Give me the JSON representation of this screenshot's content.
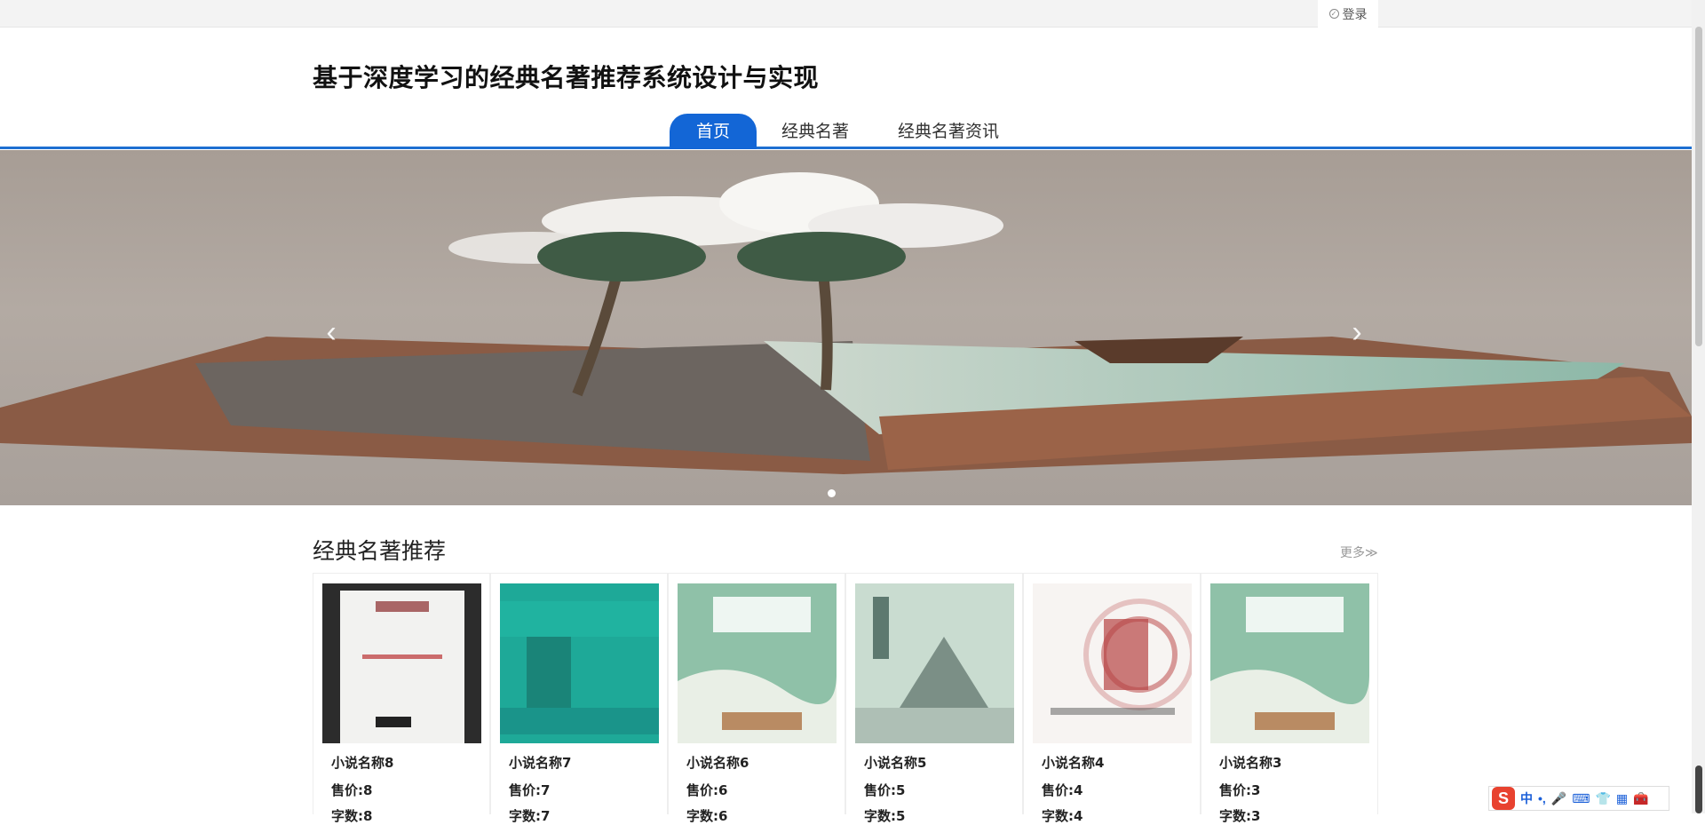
{
  "header": {
    "login_label": "登录",
    "site_title": "基于深度学习的经典名著推荐系统设计与实现"
  },
  "nav": {
    "items": [
      {
        "label": "首页",
        "active": true
      },
      {
        "label": "经典名著",
        "active": false
      },
      {
        "label": "经典名著资讯",
        "active": false
      }
    ]
  },
  "banner": {
    "prev_icon": "chevron-left-icon",
    "next_icon": "chevron-right-icon",
    "prev_glyph": "‹",
    "next_glyph": "›",
    "slides_count": 1
  },
  "recommend": {
    "title": "经典名著推荐",
    "more_label": "更多≫",
    "books": [
      {
        "name": "小说名称8",
        "price": "售价:8",
        "extra": "字数:8"
      },
      {
        "name": "小说名称7",
        "price": "售价:7",
        "extra": "字数:7"
      },
      {
        "name": "小说名称6",
        "price": "售价:6",
        "extra": "字数:6"
      },
      {
        "name": "小说名称5",
        "price": "售价:5",
        "extra": "字数:5"
      },
      {
        "name": "小说名称4",
        "price": "售价:4",
        "extra": "字数:4"
      },
      {
        "name": "小说名称3",
        "price": "售价:3",
        "extra": "字数:3"
      }
    ]
  },
  "ime": {
    "logo": "S",
    "mode": "中",
    "punct": "•,",
    "icons": [
      "microphone-icon",
      "keyboard-icon",
      "shirt-icon",
      "grid-icon",
      "toolbox-icon"
    ]
  },
  "colors": {
    "accent": "#1366d6",
    "nav_border": "#1e6fd1"
  }
}
